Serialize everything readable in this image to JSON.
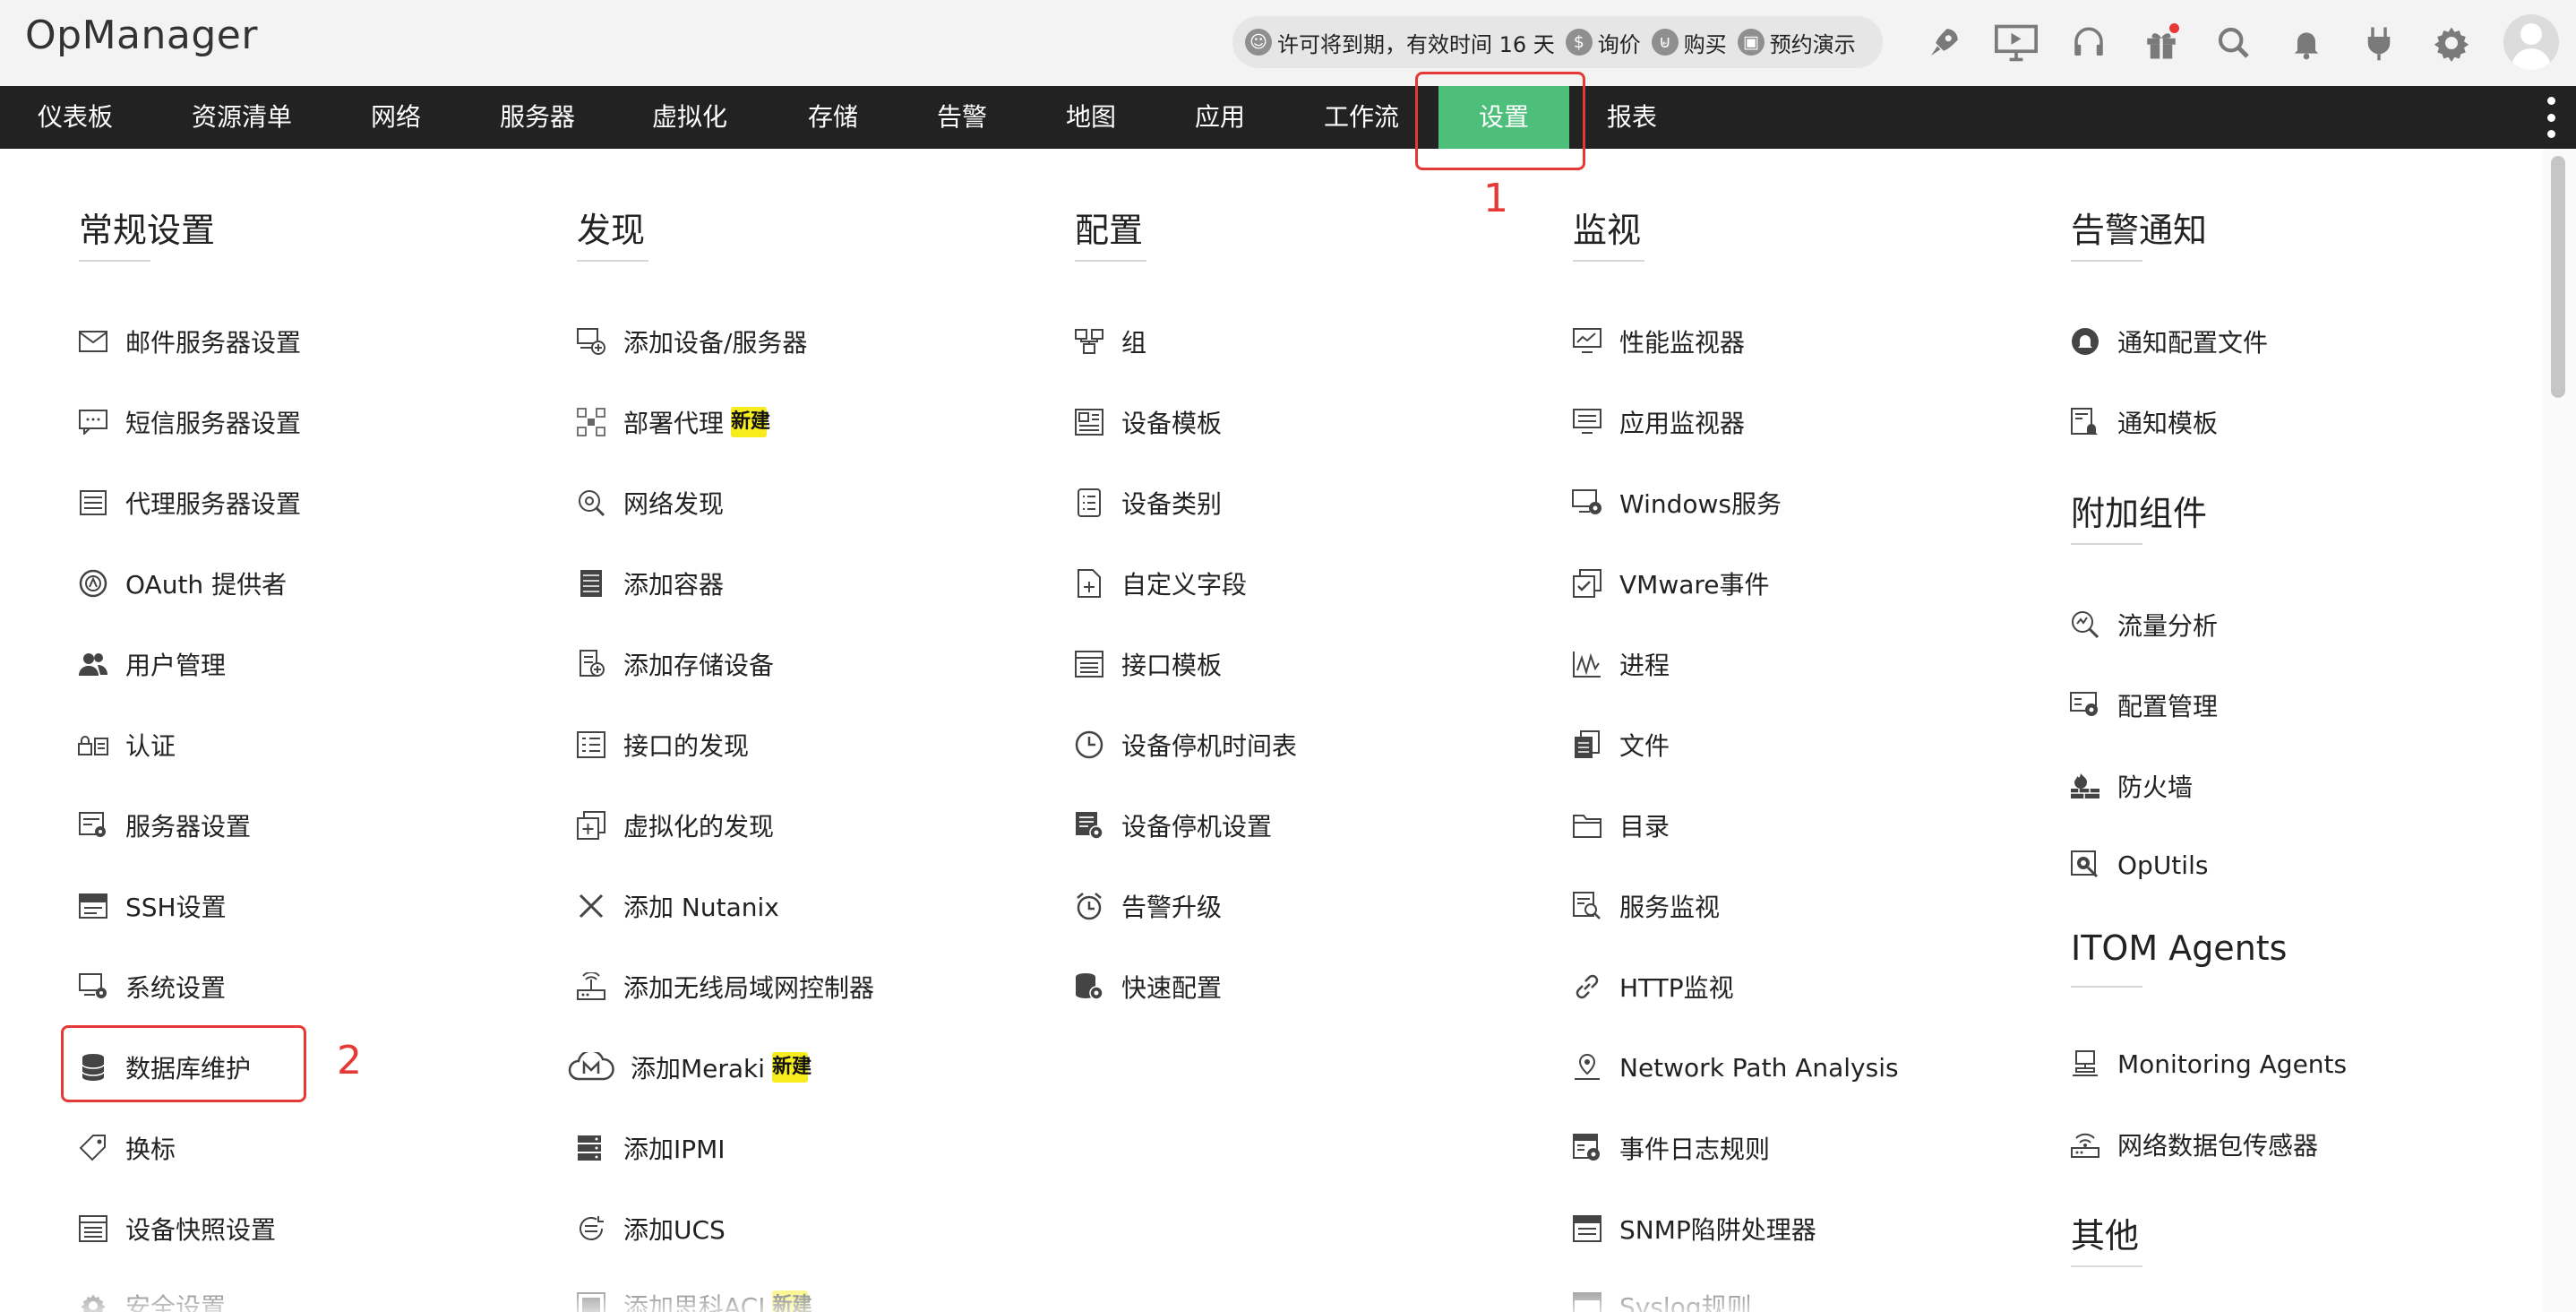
{
  "app": {
    "title": "OpManager"
  },
  "license_bar": {
    "expiry_text": "许可将到期，有效时间 16 天",
    "quote_label": "询价",
    "buy_label": "购买",
    "demo_label": "预约演示"
  },
  "header_icons": [
    "rocket-icon",
    "presentation-icon",
    "headset-icon",
    "gift-icon",
    "search-icon",
    "bell-icon",
    "plug-icon",
    "gear-icon"
  ],
  "nav": {
    "items": [
      {
        "label": "仪表板"
      },
      {
        "label": "资源清单"
      },
      {
        "label": "网络"
      },
      {
        "label": "服务器"
      },
      {
        "label": "虚拟化"
      },
      {
        "label": "存储"
      },
      {
        "label": "告警"
      },
      {
        "label": "地图"
      },
      {
        "label": "应用"
      },
      {
        "label": "工作流"
      },
      {
        "label": "设置",
        "active": true
      },
      {
        "label": "报表"
      }
    ]
  },
  "columns": {
    "general": {
      "title": "常规设置",
      "items": [
        "邮件服务器设置",
        "短信服务器设置",
        "代理服务器设置",
        "OAuth 提供者",
        "用户管理",
        "认证",
        "服务器设置",
        "SSH设置",
        "系统设置",
        "数据库维护",
        "换标",
        "设备快照设置",
        "安全设置"
      ]
    },
    "discovery": {
      "title": "发现",
      "items": [
        "添加设备/服务器",
        "部署代理",
        "网络发现",
        "添加容器",
        "添加存储设备",
        "接口的发现",
        "虚拟化的发现",
        "添加 Nutanix",
        "添加无线局域网控制器",
        "添加Meraki",
        "添加IPMI",
        "添加UCS",
        "添加思科ACI"
      ]
    },
    "config": {
      "title": "配置",
      "items": [
        "组",
        "设备模板",
        "设备类别",
        "自定义字段",
        "接口模板",
        "设备停机时间表",
        "设备停机设置",
        "告警升级",
        "快速配置"
      ]
    },
    "monitor": {
      "title": "监视",
      "items": [
        "性能监视器",
        "应用监视器",
        "Windows服务",
        "VMware事件",
        "进程",
        "文件",
        "目录",
        "服务监视",
        "HTTP监视",
        "Network Path Analysis",
        "事件日志规则",
        "SNMP陷阱处理器",
        "Syslog规则"
      ]
    },
    "alerts": {
      "title": "告警通知",
      "items": [
        "通知配置文件",
        "通知模板"
      ],
      "addons_title": "附加组件",
      "addons": [
        "流量分析",
        "配置管理",
        "防火墙",
        "OpUtils"
      ],
      "itom_title": "ITOM Agents",
      "itom": [
        "Monitoring Agents",
        "网络数据包传感器"
      ],
      "other_title": "其他"
    }
  },
  "badges": {
    "new": "新建"
  },
  "annotations": {
    "one": "1",
    "two": "2"
  },
  "colors": {
    "nav_bg": "#222222",
    "active_tab": "#4dbf7a",
    "badge": "#f7ec1e",
    "annotation": "#e53935"
  }
}
